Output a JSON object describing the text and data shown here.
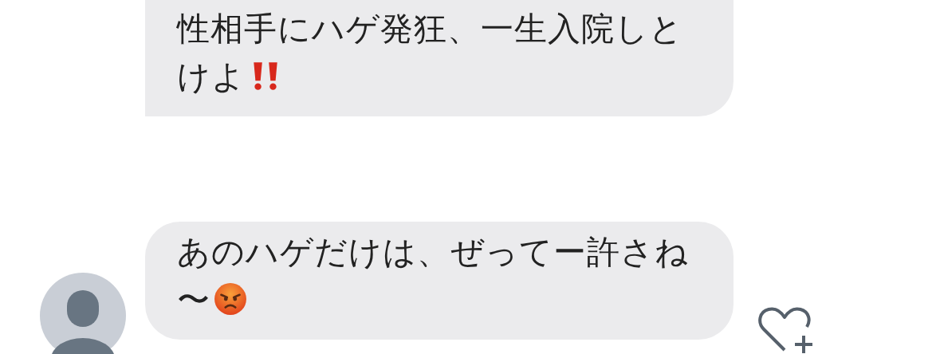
{
  "messages": [
    {
      "text": "性相手にハゲ発狂、一生入院しとけよ",
      "kind": "exclamation",
      "avatar": false,
      "reaction_button": false
    },
    {
      "text": "あのハゲだけは、ぜってー許さね〜",
      "kind": "angry",
      "avatar": true,
      "reaction_button": true
    }
  ]
}
